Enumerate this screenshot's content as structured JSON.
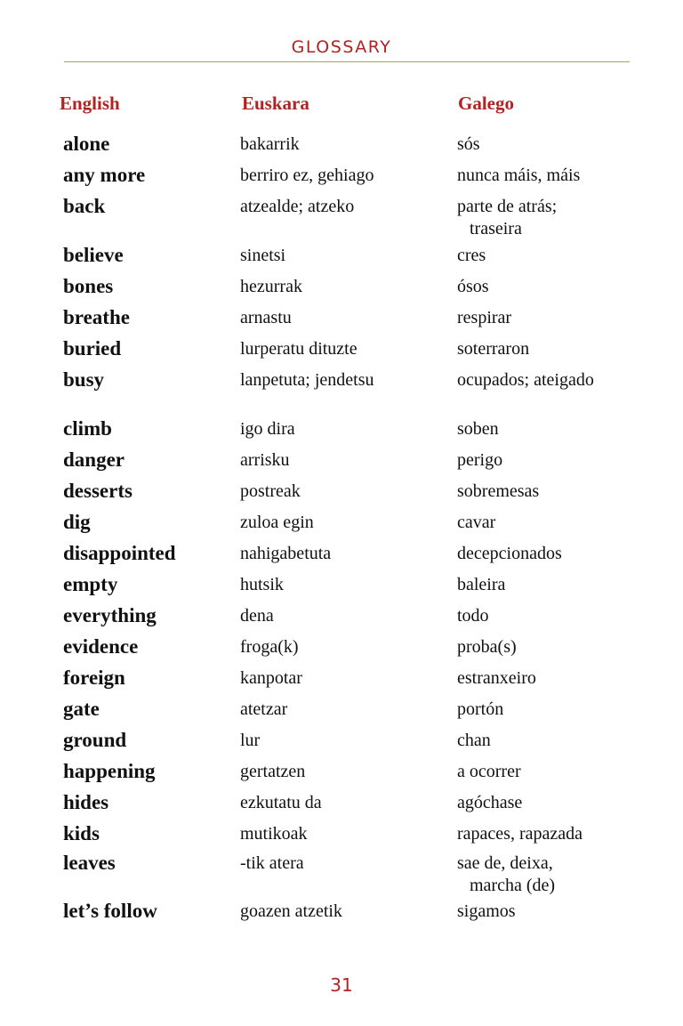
{
  "header": {
    "title": "GLOSSARY"
  },
  "columns": {
    "english": "English",
    "euskara": "Euskara",
    "galego": "Galego"
  },
  "entries": [
    {
      "en": "alone",
      "eu": "bakarrik",
      "gl": "sós",
      "gl2": ""
    },
    {
      "en": "any more",
      "eu": "berriro ez, gehiago",
      "gl": "nunca máis, máis",
      "gl2": ""
    },
    {
      "en": "back",
      "eu": "atzealde; atzeko",
      "gl": "parte de atrás;",
      "gl2": "traseira"
    },
    {
      "en": "believe",
      "eu": "sinetsi",
      "gl": "cres",
      "gl2": ""
    },
    {
      "en": "bones",
      "eu": "hezurrak",
      "gl": "ósos",
      "gl2": ""
    },
    {
      "en": "breathe",
      "eu": "arnastu",
      "gl": "respirar",
      "gl2": ""
    },
    {
      "en": "buried",
      "eu": "lurperatu dituzte",
      "gl": "soterraron",
      "gl2": ""
    },
    {
      "en": "busy",
      "eu": "lanpetuta; jendetsu",
      "gl": "ocupados; ateigado",
      "gl2": ""
    },
    {
      "en": "climb",
      "eu": "igo dira",
      "gl": "soben",
      "gl2": ""
    },
    {
      "en": "danger",
      "eu": "arrisku",
      "gl": "perigo",
      "gl2": ""
    },
    {
      "en": "desserts",
      "eu": "postreak",
      "gl": "sobremesas",
      "gl2": ""
    },
    {
      "en": "dig",
      "eu": "zuloa egin",
      "gl": "cavar",
      "gl2": ""
    },
    {
      "en": "disappointed",
      "eu": "nahigabetuta",
      "gl": "decepcionados",
      "gl2": ""
    },
    {
      "en": "empty",
      "eu": "hutsik",
      "gl": "baleira",
      "gl2": ""
    },
    {
      "en": "everything",
      "eu": "dena",
      "gl": "todo",
      "gl2": ""
    },
    {
      "en": "evidence",
      "eu": "froga(k)",
      "gl": "proba(s)",
      "gl2": ""
    },
    {
      "en": "foreign",
      "eu": "kanpotar",
      "gl": "estranxeiro",
      "gl2": ""
    },
    {
      "en": "gate",
      "eu": "atetzar",
      "gl": "portón",
      "gl2": ""
    },
    {
      "en": "ground",
      "eu": "lur",
      "gl": "chan",
      "gl2": ""
    },
    {
      "en": "happening",
      "eu": "gertatzen",
      "gl": "a ocorrer",
      "gl2": ""
    },
    {
      "en": "hides",
      "eu": "ezkutatu da",
      "gl": "agóchase",
      "gl2": ""
    },
    {
      "en": "kids",
      "eu": "mutikoak",
      "gl": "rapaces, rapazada",
      "gl2": ""
    },
    {
      "en": "leaves",
      "eu": "-tik atera",
      "gl": "sae de, deixa,",
      "gl2": "marcha (de)"
    },
    {
      "en": "let’s follow",
      "eu": "goazen atzetik",
      "gl": "sigamos",
      "gl2": ""
    }
  ],
  "footer": {
    "page_number": "31"
  }
}
